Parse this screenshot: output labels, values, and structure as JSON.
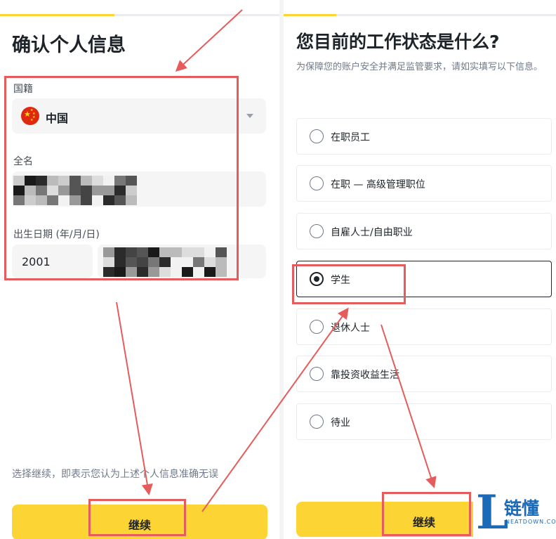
{
  "left_screen": {
    "title": "确认个人信息",
    "nationality_label": "国籍",
    "nationality_value": "中国",
    "fullname_label": "全名",
    "dob_label": "出生日期 (年/月/日)",
    "dob_year": "2001",
    "disclaimer": "选择继续，即表示您认为上述个人信息准确无误",
    "continue_label": "继续"
  },
  "right_screen": {
    "title": "您目前的工作状态是什么?",
    "subtitle": "为保障您的账户安全并满足监管要求，请如实填写以下信息。",
    "options": [
      {
        "label": "在职员工",
        "selected": false
      },
      {
        "label": "在职 — 高级管理职位",
        "selected": false
      },
      {
        "label": "自雇人士/自由职业",
        "selected": false
      },
      {
        "label": "学生",
        "selected": true
      },
      {
        "label": "退休人士",
        "selected": false
      },
      {
        "label": "靠投资收益生活",
        "selected": false
      },
      {
        "label": "待业",
        "selected": false
      }
    ],
    "continue_label": "继续"
  },
  "watermark": {
    "letter": "L",
    "name": "链懂",
    "url": "NEATDOWN.COM"
  },
  "colors": {
    "accent_yellow": "#fcd535",
    "annotation_red": "#e65b5b",
    "watermark_blue": "#1a6ab8"
  },
  "icons": {
    "flag": "china-flag-icon",
    "dropdown": "caret-down-icon",
    "radio": "radio-button-icon"
  }
}
